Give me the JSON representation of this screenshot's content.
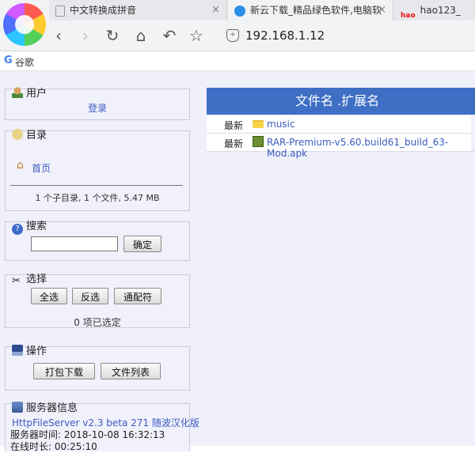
{
  "browser": {
    "tabs": [
      {
        "title": "中文转换成拼音",
        "close": "×"
      },
      {
        "title": "新云下载_精品绿色软件,电脑软",
        "close": "×"
      },
      {
        "title": "hao123_",
        "icon_text": "hao"
      }
    ],
    "address": "192.168.1.12",
    "bookmark_label": "谷歌",
    "bookmark_icon_text": "G"
  },
  "sidebar": {
    "user": {
      "title": "用户",
      "login": "登录"
    },
    "directory": {
      "title": "目录",
      "home": "首页",
      "stats": "1 个子目录, 1 个文件, 5.47 MB"
    },
    "search": {
      "title": "搜索",
      "input_value": "",
      "button": "确定"
    },
    "select": {
      "title": "选择",
      "buttons": [
        "全选",
        "反选",
        "通配符"
      ],
      "status": "0 项已选定"
    },
    "operations": {
      "title": "操作",
      "buttons": [
        "打包下载",
        "文件列表"
      ]
    },
    "server": {
      "title": "服务器信息",
      "version": "HttpFileServer v2.3 beta 271 随波汉化版",
      "time": "服务器时间: 2018-10-08 16:32:13",
      "uptime": "在线时长: 00:25:10"
    }
  },
  "files": {
    "header": "文件名 .扩展名",
    "rows": [
      {
        "badge": "最新",
        "name": "music",
        "icon": "folder-icon"
      },
      {
        "badge": "最新",
        "name": "RAR-Premium-v5.60.build61_build_63-Mod.apk",
        "icon": "apk-icon"
      }
    ]
  },
  "colors": {
    "header": "#3e6fc4",
    "panel_bg": "#f1f1fb",
    "link": "#3a5bbf"
  }
}
